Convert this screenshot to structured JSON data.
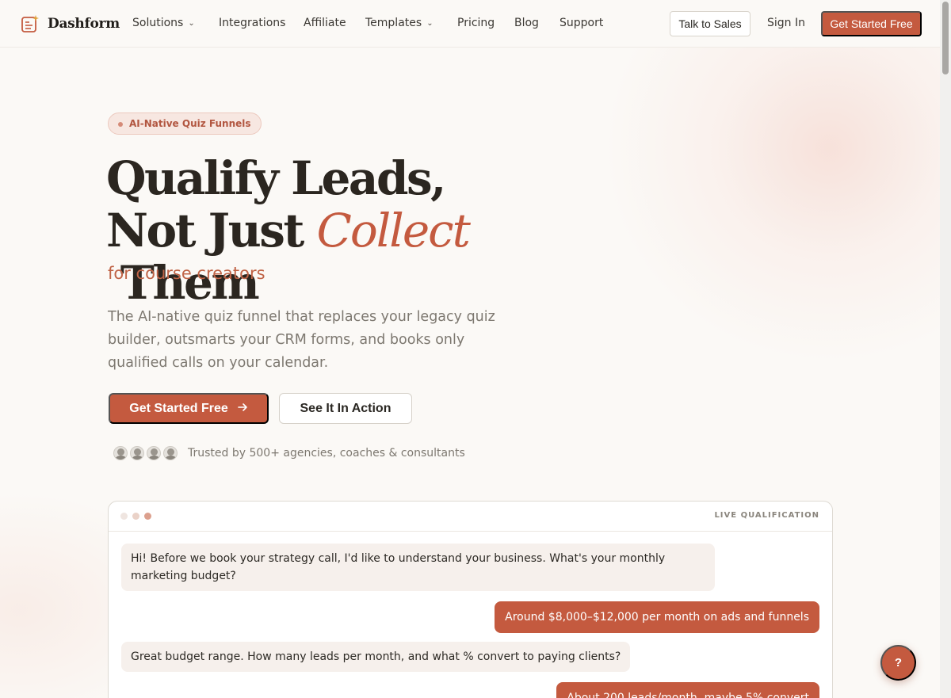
{
  "brand": {
    "name": "Dashform"
  },
  "nav": {
    "solutions": "Solutions",
    "integrations": "Integrations",
    "affiliate": "Affiliate",
    "templates": "Templates",
    "pricing": "Pricing",
    "blog": "Blog",
    "support": "Support",
    "talk_to_sales": "Talk to Sales",
    "sign_in": "Sign In",
    "get_started": "Get Started Free"
  },
  "hero": {
    "badge": "AI-Native Quiz Funnels",
    "headline_line1": "Qualify Leads,",
    "headline_line2_pre": "Not Just ",
    "headline_accent": "Collect",
    "headline_line2_post": " Them",
    "subhead": "for course creators",
    "description": "The AI-native quiz funnel that replaces your legacy quiz builder, outsmarts your CRM forms, and books only qualified calls on your calendar.",
    "cta_primary": "Get Started Free",
    "cta_secondary": "See It In Action",
    "trusted": "Trusted by 500+ agencies, coaches & consultants"
  },
  "chat": {
    "label": "LIVE QUALIFICATION",
    "messages": [
      {
        "role": "ai",
        "text": "Hi! Before we book your strategy call, I'd like to understand your business. What's your monthly marketing budget?"
      },
      {
        "role": "user",
        "text": "Around $8,000–$12,000 per month on ads and funnels"
      },
      {
        "role": "ai",
        "text": "Great budget range. How many leads per month, and what % convert to paying clients?"
      },
      {
        "role": "user",
        "text": "About 200 leads/month, maybe 5% convert"
      }
    ]
  },
  "help": {
    "label": "?"
  },
  "colors": {
    "accent": "#c45a3f",
    "background": "#fbf9f6",
    "badge_bg": "#f7e7e1"
  }
}
